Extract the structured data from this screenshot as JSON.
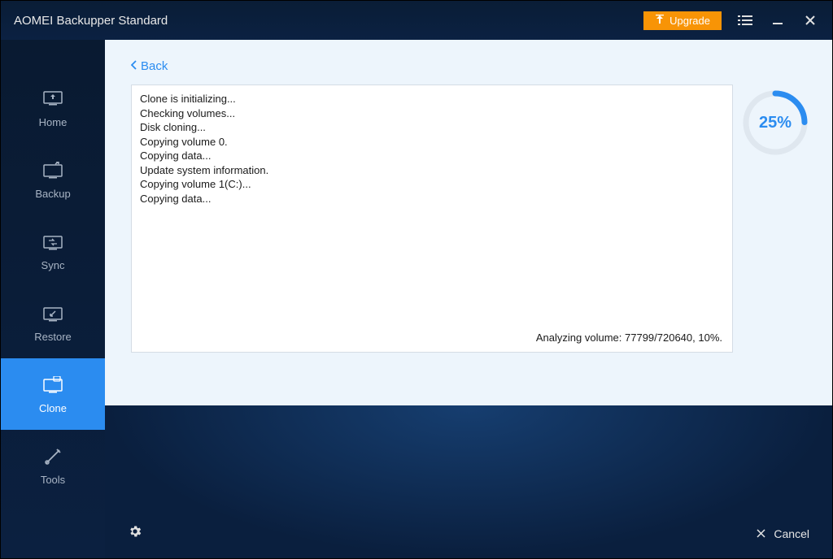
{
  "titlebar": {
    "title": "AOMEI Backupper Standard",
    "upgrade_label": "Upgrade"
  },
  "sidebar": {
    "items": [
      {
        "label": "Home"
      },
      {
        "label": "Backup"
      },
      {
        "label": "Sync"
      },
      {
        "label": "Restore"
      },
      {
        "label": "Clone"
      },
      {
        "label": "Tools"
      }
    ]
  },
  "content": {
    "back_label": "Back",
    "progress_percent": "25%",
    "progress_value": 25,
    "log_lines": [
      "Clone is initializing...",
      "Checking volumes...",
      "Disk cloning...",
      "Copying volume 0.",
      "Copying data...",
      "Update system information.",
      "Copying volume 1(C:)...",
      "Copying data..."
    ],
    "status": "Analyzing volume: 77799/720640, 10%."
  },
  "bottom": {
    "cancel_label": "Cancel"
  },
  "colors": {
    "accent": "#2b8cf0",
    "upgrade": "#f89406"
  }
}
